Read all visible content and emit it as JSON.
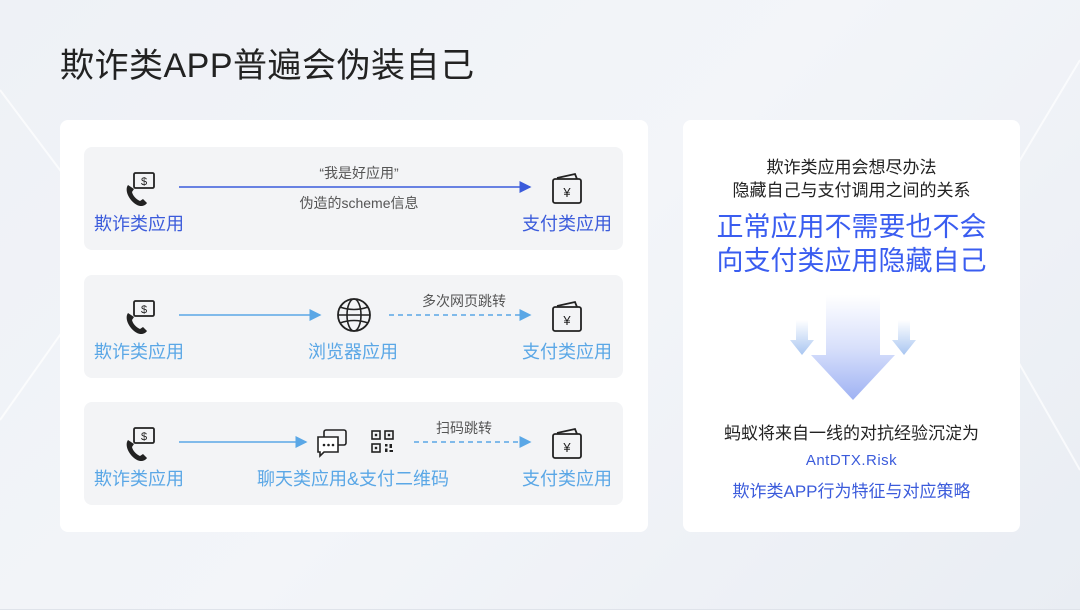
{
  "title": "欺诈类APP普遍会伪装自己",
  "flows": [
    {
      "source": "欺诈类应用",
      "target": "支付类应用",
      "arrow_top_label": "“我是好应用”",
      "arrow_bottom_label": "伪造的scheme信息"
    },
    {
      "source": "欺诈类应用",
      "middle": "浏览器应用",
      "target": "支付类应用",
      "arrow_label": "多次网页跳转"
    },
    {
      "source": "欺诈类应用",
      "middle": "聊天类应用&支付二维码",
      "target": "支付类应用",
      "arrow_label": "扫码跳转"
    }
  ],
  "right_panel": {
    "intro_line1": "欺诈类应用会想尽办法",
    "intro_line2": "隐藏自己与支付调用之间的关系",
    "emphasis_line1": "正常应用不需要也不会",
    "emphasis_line2": "向支付类应用隐藏自己",
    "conclusion": "蚂蚁将来自一线的对抗经验沉淀为",
    "code": "AntDTX.Risk",
    "strategy": "欺诈类APP行为特征与对应策略"
  },
  "icons": {
    "fraud_app": "phone-with-money-icon",
    "payment_app": "wallet-yen-icon",
    "browser": "globe-icon",
    "chat": "chat-bubbles-icon",
    "qr": "qr-code-icon",
    "arrow": "down-arrow-icon"
  },
  "colors": {
    "accent_blue": "#3b5bdb",
    "light_blue": "#5aa7e6",
    "emphasis_blue": "#3a5df0"
  }
}
